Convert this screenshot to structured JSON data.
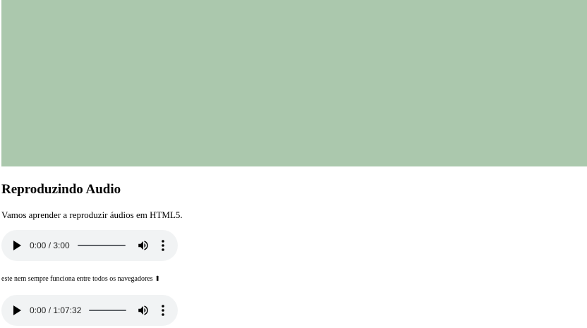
{
  "banner": {
    "color": "#abc8ad"
  },
  "heading": "Reproduzindo Audio",
  "intro": "Vamos aprender a reproduzir áudios em HTML5.",
  "note": "este nem sempre funciona entre todos os navegadores ⬆",
  "players": [
    {
      "time": "0:00 / 3:00",
      "progress": 0,
      "play_icon": "play-icon",
      "volume_icon": "volume-icon",
      "menu_icon": "more-vert-icon"
    },
    {
      "time": "0:00 / 1:07:32",
      "progress": 0,
      "play_icon": "play-icon",
      "volume_icon": "volume-icon",
      "menu_icon": "more-vert-icon"
    }
  ]
}
